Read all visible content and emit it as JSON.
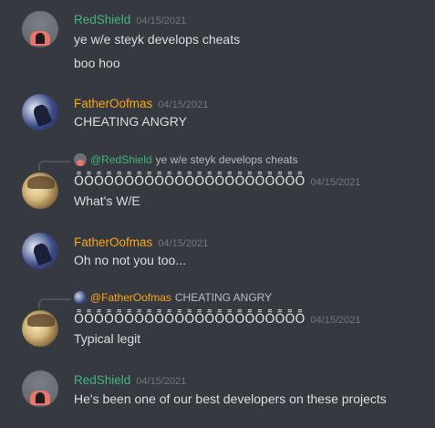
{
  "messages": [
    {
      "author": "RedShield",
      "timestamp": "04/15/2021",
      "lines": [
        "ye w/e steyk develops cheats",
        "boo hoo"
      ]
    },
    {
      "author": "FatherOofmas",
      "timestamp": "04/15/2021",
      "lines": [
        "CHEATING ANGRY"
      ]
    },
    {
      "reply_to": {
        "author": "@RedShield",
        "text": "ye w/e steyk develops cheats"
      },
      "first_line": "ȬȬȬȬȬȬȬȬȬȬȬȬȬȬȬȬȬȬȬȬȬȬȬ",
      "timestamp": "04/15/2021",
      "lines": [
        "What's W/E"
      ]
    },
    {
      "author": "FatherOofmas",
      "timestamp": "04/15/2021",
      "lines": [
        "Oh no not you too..."
      ]
    },
    {
      "reply_to": {
        "author": "@FatherOofmas",
        "text": "CHEATING ANGRY"
      },
      "first_line": "ȬȬȬȬȬȬȬȬȬȬȬȬȬȬȬȬȬȬȬȬȬȬȬ",
      "timestamp": "04/15/2021",
      "lines": [
        "Typical legit"
      ]
    },
    {
      "author": "RedShield",
      "timestamp": "04/15/2021",
      "lines": [
        "He's been one of our best developers on these projects"
      ]
    }
  ],
  "colors": {
    "background": "#36393f",
    "redshield": "#43b581",
    "fatheroofmas": "#faa61a",
    "text": "#dcddde",
    "timestamp": "#72767d"
  }
}
